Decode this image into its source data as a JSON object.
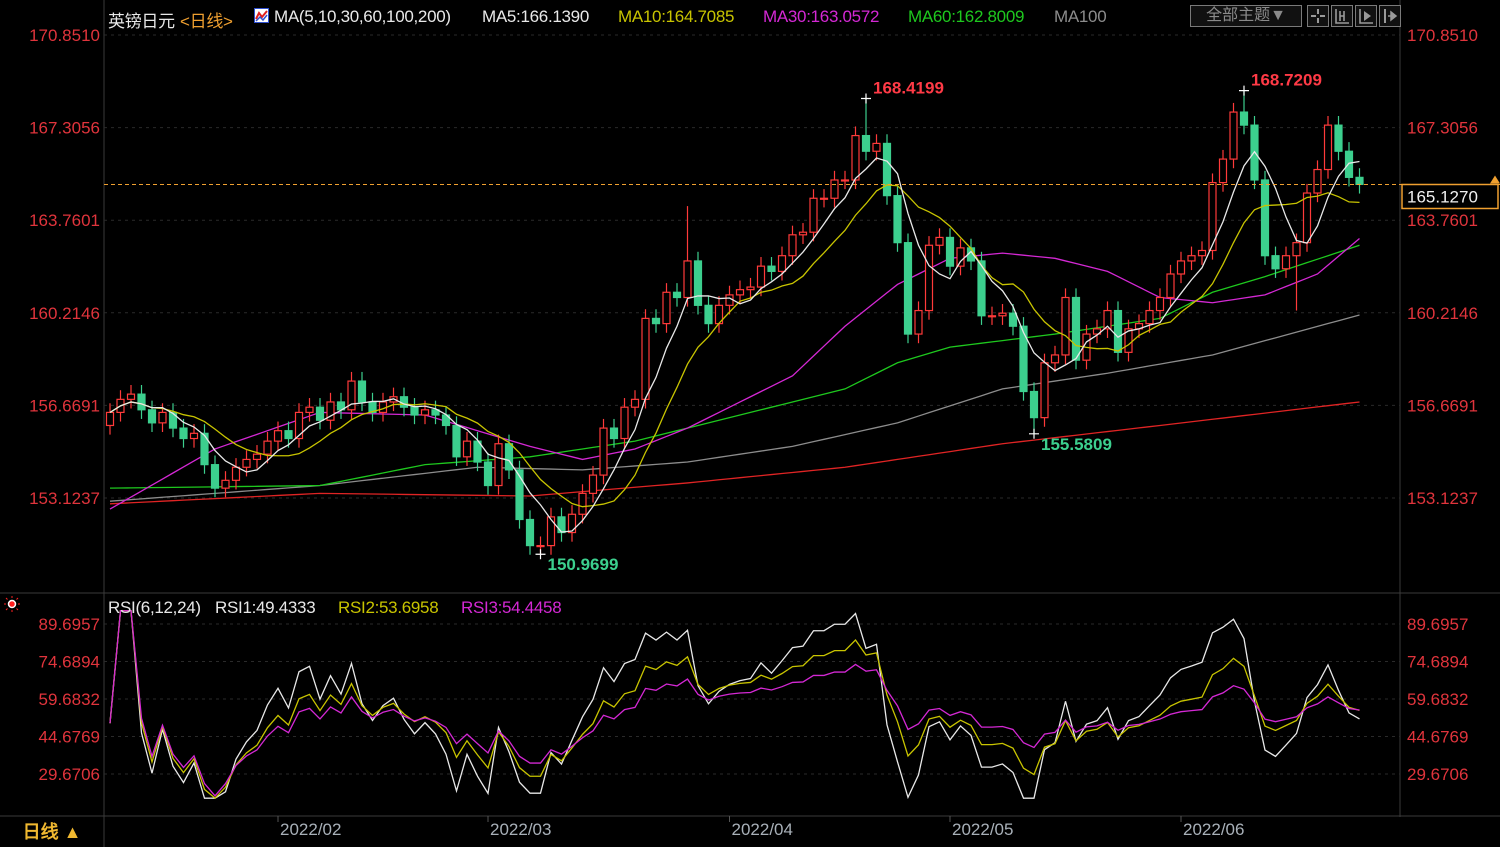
{
  "header": {
    "symbol": "英镑日元",
    "period_tag": "<日线>",
    "ma_params": "MA(5,10,30,60,100,200)",
    "ma5": "MA5:166.1390",
    "ma10": "MA10:164.7085",
    "ma30": "MA30:163.0572",
    "ma60": "MA60:162.8009",
    "ma100": "MA100",
    "theme_button": "全部主题▼",
    "tool_icons": [
      "crosshair-icon",
      "zoom-range-icon",
      "play-forward-icon",
      "move-right-icon"
    ]
  },
  "rsi_header": {
    "params": "RSI(6,12,24)",
    "rsi1": "RSI1:49.4333",
    "rsi2": "RSI2:53.6958",
    "rsi3": "RSI3:54.4458"
  },
  "period_button": "日线 ▲",
  "colors": {
    "up": "#ff3a3a",
    "down": "#3ccf8e",
    "ma5": "#e8e8e8",
    "ma10": "#c8c400",
    "ma30": "#d428d4",
    "ma60": "#1ec81e",
    "ma100": "#8c8c8c",
    "ma200": "#e02424",
    "axis_label": "#e0343c",
    "current_line": "#f0a030"
  },
  "chart_data": [
    {
      "type": "candlestick",
      "title": "英镑日元 日线",
      "y_ticks": [
        "170.8510",
        "167.3056",
        "163.7601",
        "160.2146",
        "156.6691",
        "153.1237"
      ],
      "ylim": [
        149.5,
        171.8
      ],
      "x_ticks": [
        {
          "label": "2022/02",
          "index": 16
        },
        {
          "label": "2022/03",
          "index": 36
        },
        {
          "label": "2022/04",
          "index": 59
        },
        {
          "label": "2022/05",
          "index": 80
        },
        {
          "label": "2022/06",
          "index": 102
        }
      ],
      "current_price": "165.1270",
      "current_value": 165.127,
      "closes": [
        156.4,
        156.9,
        157.1,
        156.5,
        156.0,
        156.4,
        155.8,
        155.4,
        155.6,
        154.4,
        153.5,
        153.8,
        154.3,
        154.6,
        154.8,
        155.3,
        155.7,
        155.4,
        156.4,
        156.6,
        156.1,
        156.8,
        156.5,
        157.6,
        156.8,
        156.4,
        156.8,
        157.0,
        156.6,
        156.3,
        156.5,
        156.3,
        155.9,
        154.7,
        155.3,
        154.5,
        153.6,
        155.2,
        154.2,
        152.3,
        151.3,
        151.3,
        152.4,
        151.8,
        152.5,
        153.3,
        154.0,
        155.8,
        155.4,
        156.6,
        156.9,
        160.0,
        159.8,
        161.0,
        160.8,
        162.2,
        160.5,
        159.8,
        160.5,
        160.9,
        161.1,
        161.2,
        162.0,
        161.8,
        162.4,
        163.2,
        163.3,
        164.6,
        164.6,
        165.3,
        165.3,
        167.0,
        166.4,
        166.7,
        164.7,
        162.9,
        159.4,
        160.3,
        162.8,
        163.1,
        162.0,
        162.7,
        162.2,
        160.1,
        160.1,
        160.2,
        159.7,
        157.2,
        156.2,
        158.3,
        158.6,
        160.8,
        158.4,
        159.4,
        159.6,
        160.3,
        158.7,
        159.6,
        159.8,
        160.3,
        160.8,
        161.7,
        162.2,
        162.4,
        162.6,
        165.2,
        166.1,
        167.9,
        167.4,
        165.3,
        162.4,
        161.9,
        162.4,
        162.9,
        164.8,
        165.7,
        167.4,
        166.4,
        165.4,
        165.13
      ],
      "first_open": 155.9,
      "extremes": [
        {
          "index": 41,
          "type": "low",
          "value": 150.9699,
          "label": "150.9699"
        },
        {
          "index": 72,
          "type": "high",
          "value": 168.4199,
          "label": "168.4199"
        },
        {
          "index": 88,
          "type": "low",
          "value": 155.5809,
          "label": "155.5809"
        },
        {
          "index": 108,
          "type": "high",
          "value": 168.7209,
          "label": "168.7209"
        },
        {
          "index": 55,
          "type": "high",
          "value": 164.3
        },
        {
          "index": 113,
          "type": "low",
          "value": 160.3
        }
      ],
      "moving_averages_long": {
        "ma30": [
          [
            0,
            152.7
          ],
          [
            10,
            155.0
          ],
          [
            20,
            156.4
          ],
          [
            30,
            156.3
          ],
          [
            40,
            155.1
          ],
          [
            45,
            154.6
          ],
          [
            50,
            155.0
          ],
          [
            55,
            155.8
          ],
          [
            60,
            156.8
          ],
          [
            65,
            157.8
          ],
          [
            70,
            159.7
          ],
          [
            75,
            161.3
          ],
          [
            80,
            162.3
          ],
          [
            85,
            162.5
          ],
          [
            90,
            162.3
          ],
          [
            95,
            161.8
          ],
          [
            100,
            160.8
          ],
          [
            105,
            160.6
          ],
          [
            110,
            160.9
          ],
          [
            115,
            161.7
          ],
          [
            119,
            163.06
          ]
        ],
        "ma60": [
          [
            0,
            153.5
          ],
          [
            20,
            153.6
          ],
          [
            30,
            154.4
          ],
          [
            40,
            154.7
          ],
          [
            50,
            155.3
          ],
          [
            60,
            156.3
          ],
          [
            70,
            157.3
          ],
          [
            75,
            158.3
          ],
          [
            80,
            158.9
          ],
          [
            90,
            159.4
          ],
          [
            100,
            160.0
          ],
          [
            105,
            161.0
          ],
          [
            110,
            161.6
          ],
          [
            119,
            162.8
          ]
        ],
        "ma100": [
          [
            0,
            153.0
          ],
          [
            20,
            153.6
          ],
          [
            35,
            154.3
          ],
          [
            45,
            154.2
          ],
          [
            55,
            154.5
          ],
          [
            65,
            155.1
          ],
          [
            75,
            156.0
          ],
          [
            85,
            157.3
          ],
          [
            95,
            157.9
          ],
          [
            105,
            158.6
          ],
          [
            119,
            160.13
          ]
        ],
        "ma200": [
          [
            0,
            152.9
          ],
          [
            20,
            153.3
          ],
          [
            40,
            153.2
          ],
          [
            55,
            153.7
          ],
          [
            70,
            154.3
          ],
          [
            85,
            155.2
          ],
          [
            100,
            155.9
          ],
          [
            119,
            156.8
          ]
        ]
      }
    },
    {
      "type": "line",
      "title": "RSI(6,12,24)",
      "y_ticks": [
        "89.6957",
        "74.6894",
        "59.6832",
        "44.6769",
        "29.6706"
      ],
      "series": [
        {
          "name": "RSI1",
          "period": 6
        },
        {
          "name": "RSI2",
          "period": 12
        },
        {
          "name": "RSI3",
          "period": 24
        }
      ]
    }
  ]
}
